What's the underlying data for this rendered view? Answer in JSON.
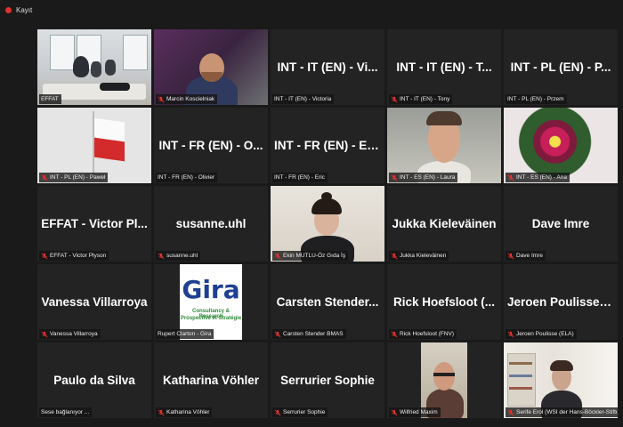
{
  "app": {
    "record_label": "Kayıt"
  },
  "tiles": [
    {
      "title": "",
      "caption": "EFFAT",
      "mic_muted": false
    },
    {
      "title": "",
      "caption": "Marcin Koscielniak",
      "mic_muted": false
    },
    {
      "title": "INT - IT (EN) - Vi...",
      "caption": "INT - IT (EN) - Victoria",
      "mic_muted": false
    },
    {
      "title": "INT - IT (EN) - T...",
      "caption": "INT - IT (EN) - Tony",
      "mic_muted": true
    },
    {
      "title": "INT - PL (EN) - P...",
      "caption": "INT - PL (EN) - Przem",
      "mic_muted": false
    },
    {
      "title": "",
      "caption": "INT - PL (EN) - Paweł",
      "mic_muted": true
    },
    {
      "title": "INT - FR (EN) - O...",
      "caption": "INT - FR (EN) - Olivier",
      "mic_muted": false
    },
    {
      "title": "INT - FR (EN) - Eric",
      "caption": "INT - FR (EN) - Eric",
      "mic_muted": false
    },
    {
      "title": "",
      "caption": "INT - ES (EN) - Laura",
      "mic_muted": true
    },
    {
      "title": "",
      "caption": "INT - ES (EN) - Ana",
      "mic_muted": true
    },
    {
      "title": "EFFAT - Victor Pl...",
      "caption": "EFFAT - Victor Plyson",
      "mic_muted": true
    },
    {
      "title": "susanne.uhl",
      "caption": "susanne.uhl",
      "mic_muted": true
    },
    {
      "title": "",
      "caption": "Ekin MUTLU-Öz Gıda İş",
      "mic_muted": true
    },
    {
      "title": "Jukka Kieleväinen",
      "caption": "Jukka Kieleväinen",
      "mic_muted": true
    },
    {
      "title": "Dave Imre",
      "caption": "Dave Imre",
      "mic_muted": true
    },
    {
      "title": "Vanessa Villarroya",
      "caption": "Vanessa Villarroya",
      "mic_muted": true
    },
    {
      "title": "",
      "caption": "Rupert Clarton - Gira",
      "mic_muted": false
    },
    {
      "title": "Carsten Stender...",
      "caption": "Carsten Stender BMAS",
      "mic_muted": true
    },
    {
      "title": "Rick Hoefsloot (...",
      "caption": "Rick Hoefsloot (FNV)",
      "mic_muted": true
    },
    {
      "title": "Jeroen Poulisse (...",
      "caption": "Jeroen Poulisse (ELA)",
      "mic_muted": true
    },
    {
      "title": "Paulo da Silva",
      "caption": "Sese bağlanıyor ...",
      "mic_muted": false
    },
    {
      "title": "Katharina Vöhler",
      "caption": "Katharina Vöhler",
      "mic_muted": true
    },
    {
      "title": "Serrurier Sophie",
      "caption": "Serrurier Sophie",
      "mic_muted": true
    },
    {
      "title": "",
      "caption": "Wilfried Maxim",
      "mic_muted": true
    },
    {
      "title": "",
      "caption": "Serife Erol (WSI der Hans-Böckler-Stiftu...",
      "mic_muted": true
    }
  ],
  "gira_logo": {
    "word": "Gira",
    "line1": "Consultancy & Research",
    "line2": "Prospective et Stratégie"
  },
  "colors": {
    "active_speaker_border": "#b5d44a",
    "record_dot": "#e0322f",
    "muted_mic": "#e0322f",
    "background": "#1a1a1a",
    "tile": "#232323"
  }
}
